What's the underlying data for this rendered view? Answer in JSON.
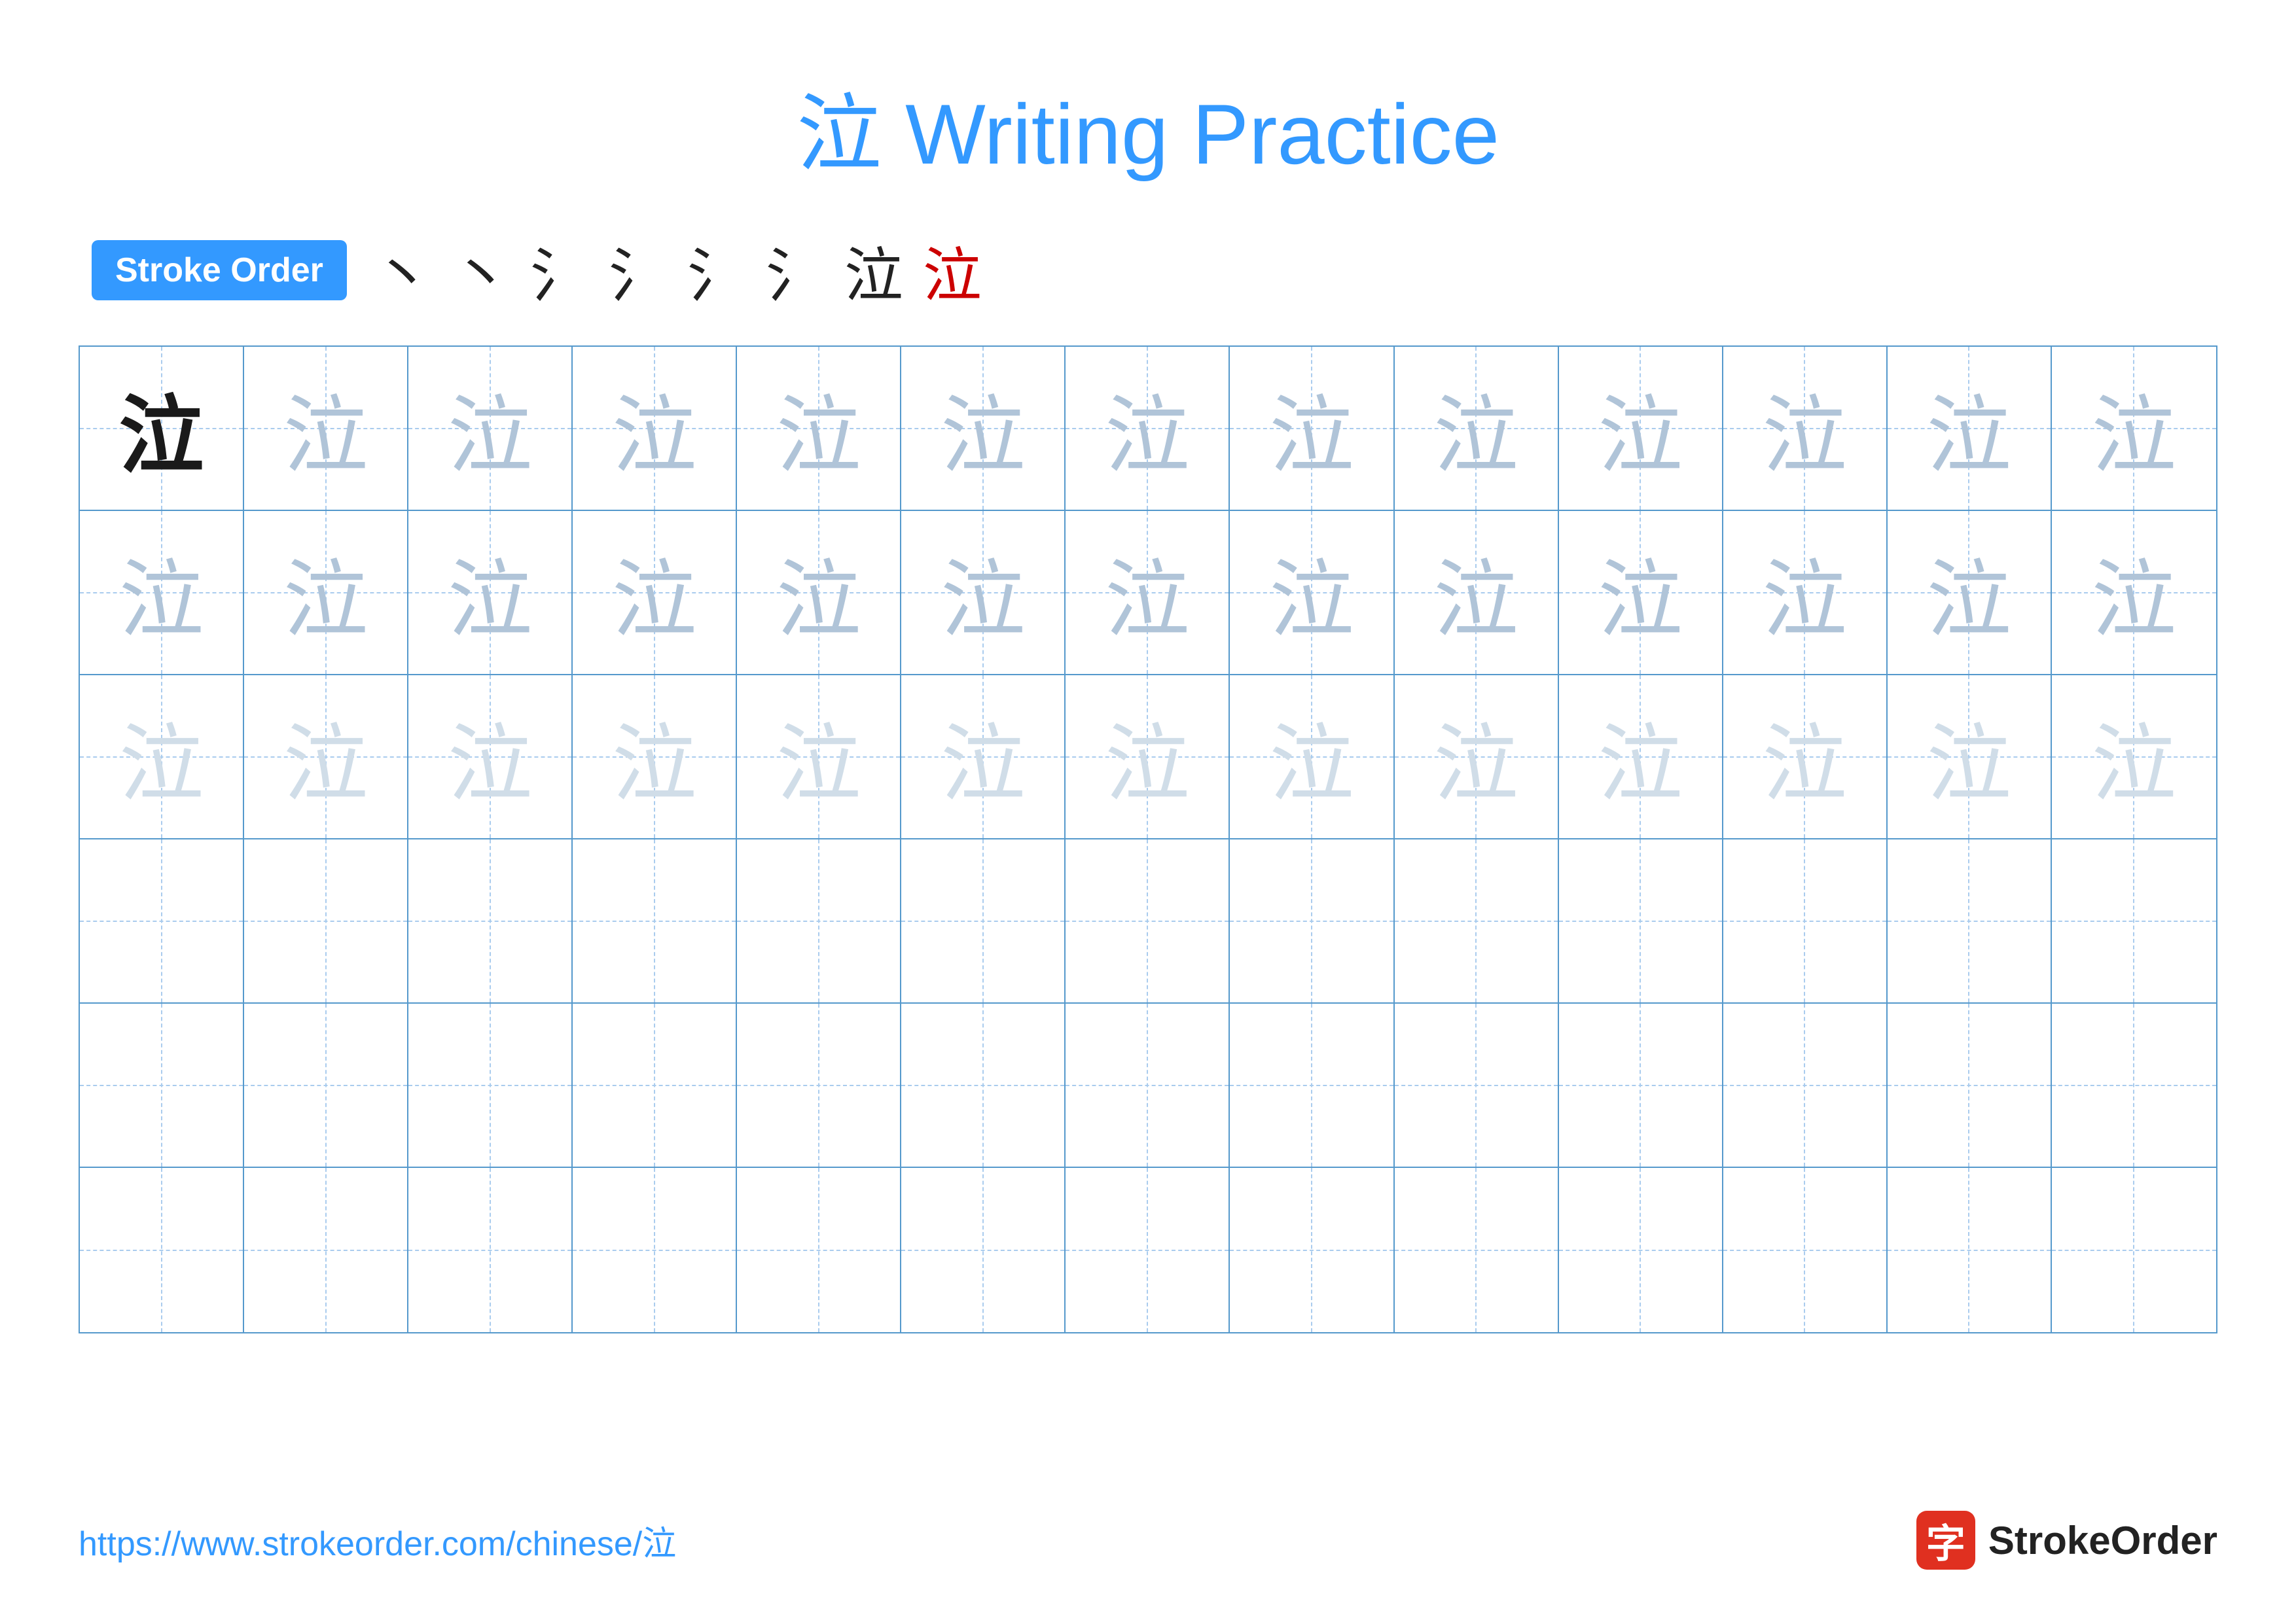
{
  "title": "泣 Writing Practice",
  "stroke_order_badge": "Stroke Order",
  "stroke_sequence": [
    "丶",
    "丶",
    "氵",
    "氵",
    "氵",
    "氵",
    "泣",
    "泣"
  ],
  "character": "泣",
  "grid": {
    "rows": 6,
    "cols": 13,
    "row_types": [
      "dark-then-medium",
      "light",
      "light",
      "empty",
      "empty",
      "empty"
    ]
  },
  "footer": {
    "url": "https://www.strokeorder.com/chinese/泣",
    "brand_icon": "字",
    "brand_name": "StrokeOrder"
  }
}
